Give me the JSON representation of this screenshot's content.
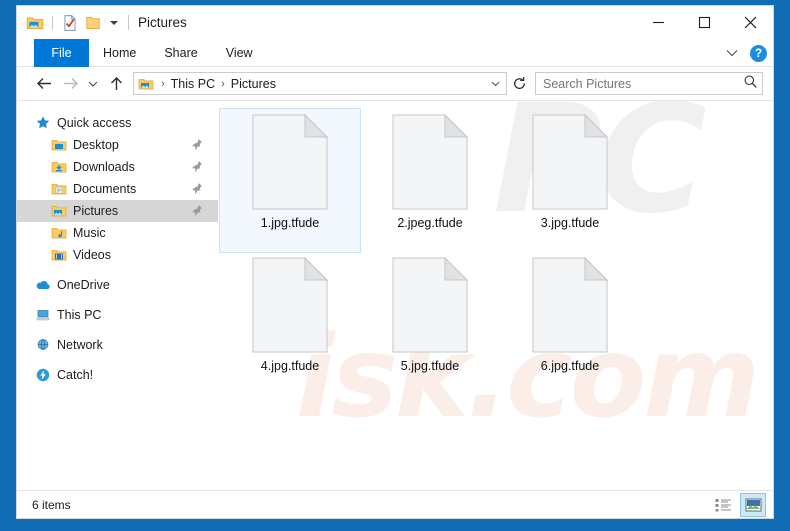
{
  "window": {
    "title": "Pictures",
    "quick_access_toolbar": [
      {
        "name": "pictures-folder-icon",
        "label": "Pictures folder"
      },
      {
        "name": "properties-icon",
        "label": "Properties"
      },
      {
        "name": "new-folder-icon",
        "label": "New folder"
      },
      {
        "name": "customize-qat-caret-icon",
        "label": "Customize Quick Access Toolbar"
      }
    ],
    "controls": {
      "minimize": "Minimize",
      "maximize": "Maximize",
      "close": "Close"
    }
  },
  "ribbon": {
    "tabs": [
      {
        "label": "File",
        "active": true
      },
      {
        "label": "Home",
        "active": false
      },
      {
        "label": "Share",
        "active": false
      },
      {
        "label": "View",
        "active": false
      }
    ],
    "collapse_label": "Minimize the Ribbon",
    "help_label": "?"
  },
  "address_bar": {
    "back": "Back",
    "forward": "Forward",
    "recent": "Recent locations",
    "up": "Up",
    "breadcrumb": [
      {
        "label": "This PC"
      },
      {
        "label": "Pictures"
      }
    ],
    "separator": "›",
    "refresh": "Refresh"
  },
  "search": {
    "placeholder": "Search Pictures",
    "value": ""
  },
  "sidebar": {
    "groups": [
      {
        "header": {
          "label": "Quick access",
          "icon": "star-icon"
        },
        "items": [
          {
            "label": "Desktop",
            "icon": "desktop-folder-icon",
            "pinned": true,
            "selected": false
          },
          {
            "label": "Downloads",
            "icon": "downloads-folder-icon",
            "pinned": true,
            "selected": false
          },
          {
            "label": "Documents",
            "icon": "documents-folder-icon",
            "pinned": true,
            "selected": false
          },
          {
            "label": "Pictures",
            "icon": "pictures-folder-icon",
            "pinned": true,
            "selected": true
          },
          {
            "label": "Music",
            "icon": "music-folder-icon",
            "pinned": false,
            "selected": false
          },
          {
            "label": "Videos",
            "icon": "videos-folder-icon",
            "pinned": false,
            "selected": false
          }
        ]
      },
      {
        "header": null,
        "items": [
          {
            "label": "OneDrive",
            "icon": "onedrive-cloud-icon",
            "pinned": false,
            "selected": false
          },
          {
            "label": "This PC",
            "icon": "this-pc-icon",
            "pinned": false,
            "selected": false
          },
          {
            "label": "Network",
            "icon": "network-icon",
            "pinned": false,
            "selected": false
          },
          {
            "label": "Catch!",
            "icon": "catch-icon",
            "pinned": false,
            "selected": false
          }
        ]
      }
    ]
  },
  "files": [
    {
      "name": "1.jpg.tfude",
      "selected": true
    },
    {
      "name": "2.jpeg.tfude",
      "selected": false
    },
    {
      "name": "3.jpg.tfude",
      "selected": false
    },
    {
      "name": "4.jpg.tfude",
      "selected": false
    },
    {
      "name": "5.jpg.tfude",
      "selected": false
    },
    {
      "name": "6.jpg.tfude",
      "selected": false
    }
  ],
  "watermark": {
    "top": "PC",
    "bottom": "isk.com"
  },
  "status_bar": {
    "item_count": "6 items",
    "views": [
      {
        "name": "details-view-button",
        "active": false
      },
      {
        "name": "large-icons-view-button",
        "active": true
      }
    ]
  },
  "colors": {
    "desktop": "#0f6cb5",
    "accent": "#0078d7",
    "selection": "#f2f8fd",
    "sidebar_selected": "#d6d6d6",
    "help_blue": "#1b8ce0"
  }
}
